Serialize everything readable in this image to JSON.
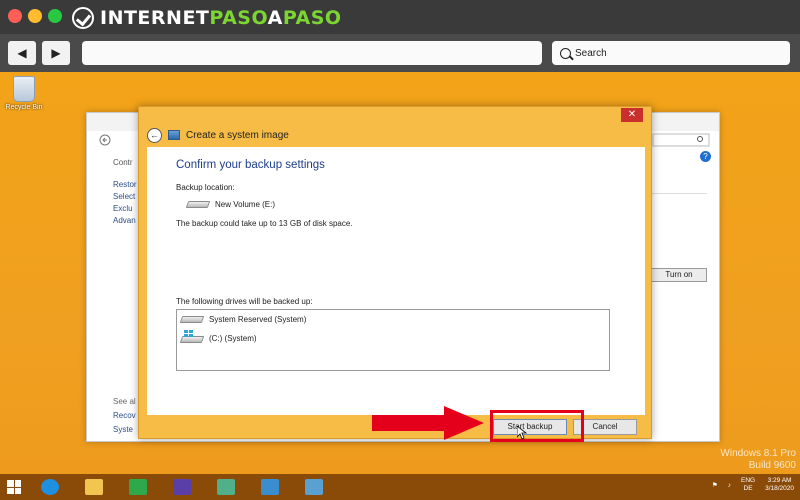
{
  "branding": {
    "logo_part1": "INTERNET",
    "logo_part2": "PASO",
    "logo_part3": "A",
    "logo_part4": "PASO"
  },
  "browser": {
    "search_placeholder": "Search"
  },
  "desktop": {
    "recycle_bin_label": "Recycle Bin"
  },
  "background_window": {
    "sidebar_title": "Contr",
    "sidebar_items": [
      "Restor",
      "Select",
      "Exclu",
      "Advan"
    ],
    "bottom_items": [
      "See al",
      "Recov",
      "Syste"
    ],
    "turn_on_label": "Turn on",
    "help_label": "?"
  },
  "dialog": {
    "title": "Create a system image",
    "close_label": "✕",
    "heading": "Confirm your backup settings",
    "backup_location_label": "Backup location:",
    "backup_volume": "New Volume (E:)",
    "space_note": "The backup could take up to 13 GB of disk space.",
    "drives_label": "The following drives will be backed up:",
    "drives": [
      "System Reserved (System)",
      "(C:) (System)"
    ],
    "start_backup_label": "Start backup",
    "cancel_label": "Cancel"
  },
  "watermark": {
    "line1": "Windows 8.1 Pro",
    "line2": "Build 9600"
  },
  "taskbar": {
    "tray_lang_1": "ENG",
    "tray_lang_2": "DE",
    "time": "3:29 AM",
    "date": "3/18/2020"
  },
  "colors": {
    "desktop": "#f2a318",
    "dialog_frame": "#f6bc45",
    "heading_blue": "#1e3d8a",
    "highlight_red": "#e4001a",
    "taskbar": "#8a4b08"
  }
}
